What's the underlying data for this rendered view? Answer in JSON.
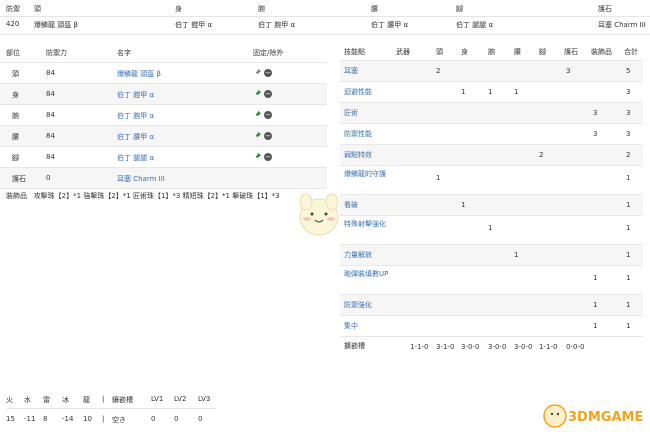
{
  "summary": {
    "headers": [
      "防禦",
      "頭",
      "身",
      "腕",
      "腰",
      "腳",
      "護石"
    ],
    "values": [
      "420",
      "爆鱗龍 頭盔 β",
      "伯丁 鎧甲 α",
      "伯丁 腕甲 α",
      "伯丁 腰甲 α",
      "伯丁 腿腿 α",
      "耳塞 Charm III"
    ]
  },
  "equipment": {
    "headers": [
      "部位",
      "防禦力",
      "名字",
      "固定/除外"
    ],
    "rows": [
      {
        "part": "頭",
        "def": "84",
        "name": "爆鱗龍 頭盔 β",
        "pin": "gray"
      },
      {
        "part": "身",
        "def": "84",
        "name": "伯丁 鎧甲 α",
        "pin": "green"
      },
      {
        "part": "腕",
        "def": "84",
        "name": "伯丁 腕甲 α",
        "pin": "green"
      },
      {
        "part": "腰",
        "def": "84",
        "name": "伯丁 腰甲 α",
        "pin": "green"
      },
      {
        "part": "腳",
        "def": "84",
        "name": "伯丁 腿腿 α",
        "pin": "green"
      },
      {
        "part": "護石",
        "def": "0",
        "name": "耳塞 Charm III",
        "pin": "none"
      }
    ],
    "deco_label": "裝飾品",
    "deco_text": "攻擊珠【2】*1 強擊珠【2】*1 匠術珠【1】*3 精短珠【2】*1 擊破珠【1】*3"
  },
  "skills": {
    "headers": [
      "技能點",
      "武器",
      "頭",
      "身",
      "腕",
      "腰",
      "腳",
      "護石",
      "裝飾品",
      "合計"
    ],
    "rows": [
      {
        "name": "耳塞",
        "cells": [
          "",
          "2",
          "",
          "",
          "",
          "",
          "3",
          "",
          "5"
        ]
      },
      {
        "name": "迴避性能",
        "cells": [
          "",
          "",
          "1",
          "1",
          "1",
          "",
          "",
          "",
          "3"
        ]
      },
      {
        "name": "匠術",
        "cells": [
          "",
          "",
          "",
          "",
          "",
          "",
          "",
          "3",
          "3"
        ]
      },
      {
        "name": "防禦性能",
        "cells": [
          "",
          "",
          "",
          "",
          "",
          "",
          "",
          "3",
          "3"
        ]
      },
      {
        "name": "弱點特效",
        "cells": [
          "",
          "",
          "",
          "",
          "",
          "2",
          "",
          "",
          "2"
        ]
      },
      {
        "name": "爆鱗龍的守護",
        "cells": [
          "",
          "1",
          "",
          "",
          "",
          "",
          "",
          "",
          "1"
        ]
      },
      {
        "name": "看破",
        "cells": [
          "",
          "",
          "1",
          "",
          "",
          "",
          "",
          "",
          "1"
        ]
      },
      {
        "name": "特殊射擊強化",
        "cells": [
          "",
          "",
          "",
          "1",
          "",
          "",
          "",
          "",
          "1"
        ]
      },
      {
        "name": "力量解放",
        "cells": [
          "",
          "",
          "",
          "",
          "1",
          "",
          "",
          "",
          "1"
        ]
      },
      {
        "name": "砲彈裝填數UP",
        "cells": [
          "",
          "",
          "",
          "",
          "",
          "",
          "",
          "1",
          "1"
        ]
      },
      {
        "name": "防禦強化",
        "cells": [
          "",
          "",
          "",
          "",
          "",
          "",
          "",
          "1",
          "1"
        ]
      },
      {
        "name": "集中",
        "cells": [
          "",
          "",
          "",
          "",
          "",
          "",
          "",
          "1",
          "1"
        ]
      }
    ],
    "slot_label": "擴嵌槽",
    "slots": [
      "1-1-0",
      "3-1-0",
      "3-0-0",
      "3-0-0",
      "3-0-0",
      "1-1-0",
      "0-0-0"
    ]
  },
  "resist": {
    "headers": [
      "火",
      "水",
      "雷",
      "冰",
      "龍",
      "|",
      "鑲嵌槽",
      "LV1",
      "LV2",
      "LV3"
    ],
    "values": [
      "15",
      "-11",
      "8",
      "-14",
      "10",
      "|",
      "空き",
      "0",
      "0",
      "0"
    ]
  },
  "watermark": "3DMGAME",
  "colors": {
    "link": "#3a6fb0",
    "pin_green": "#2e8b3a",
    "pin_gray": "#888888",
    "brand": "#f4a31a"
  }
}
